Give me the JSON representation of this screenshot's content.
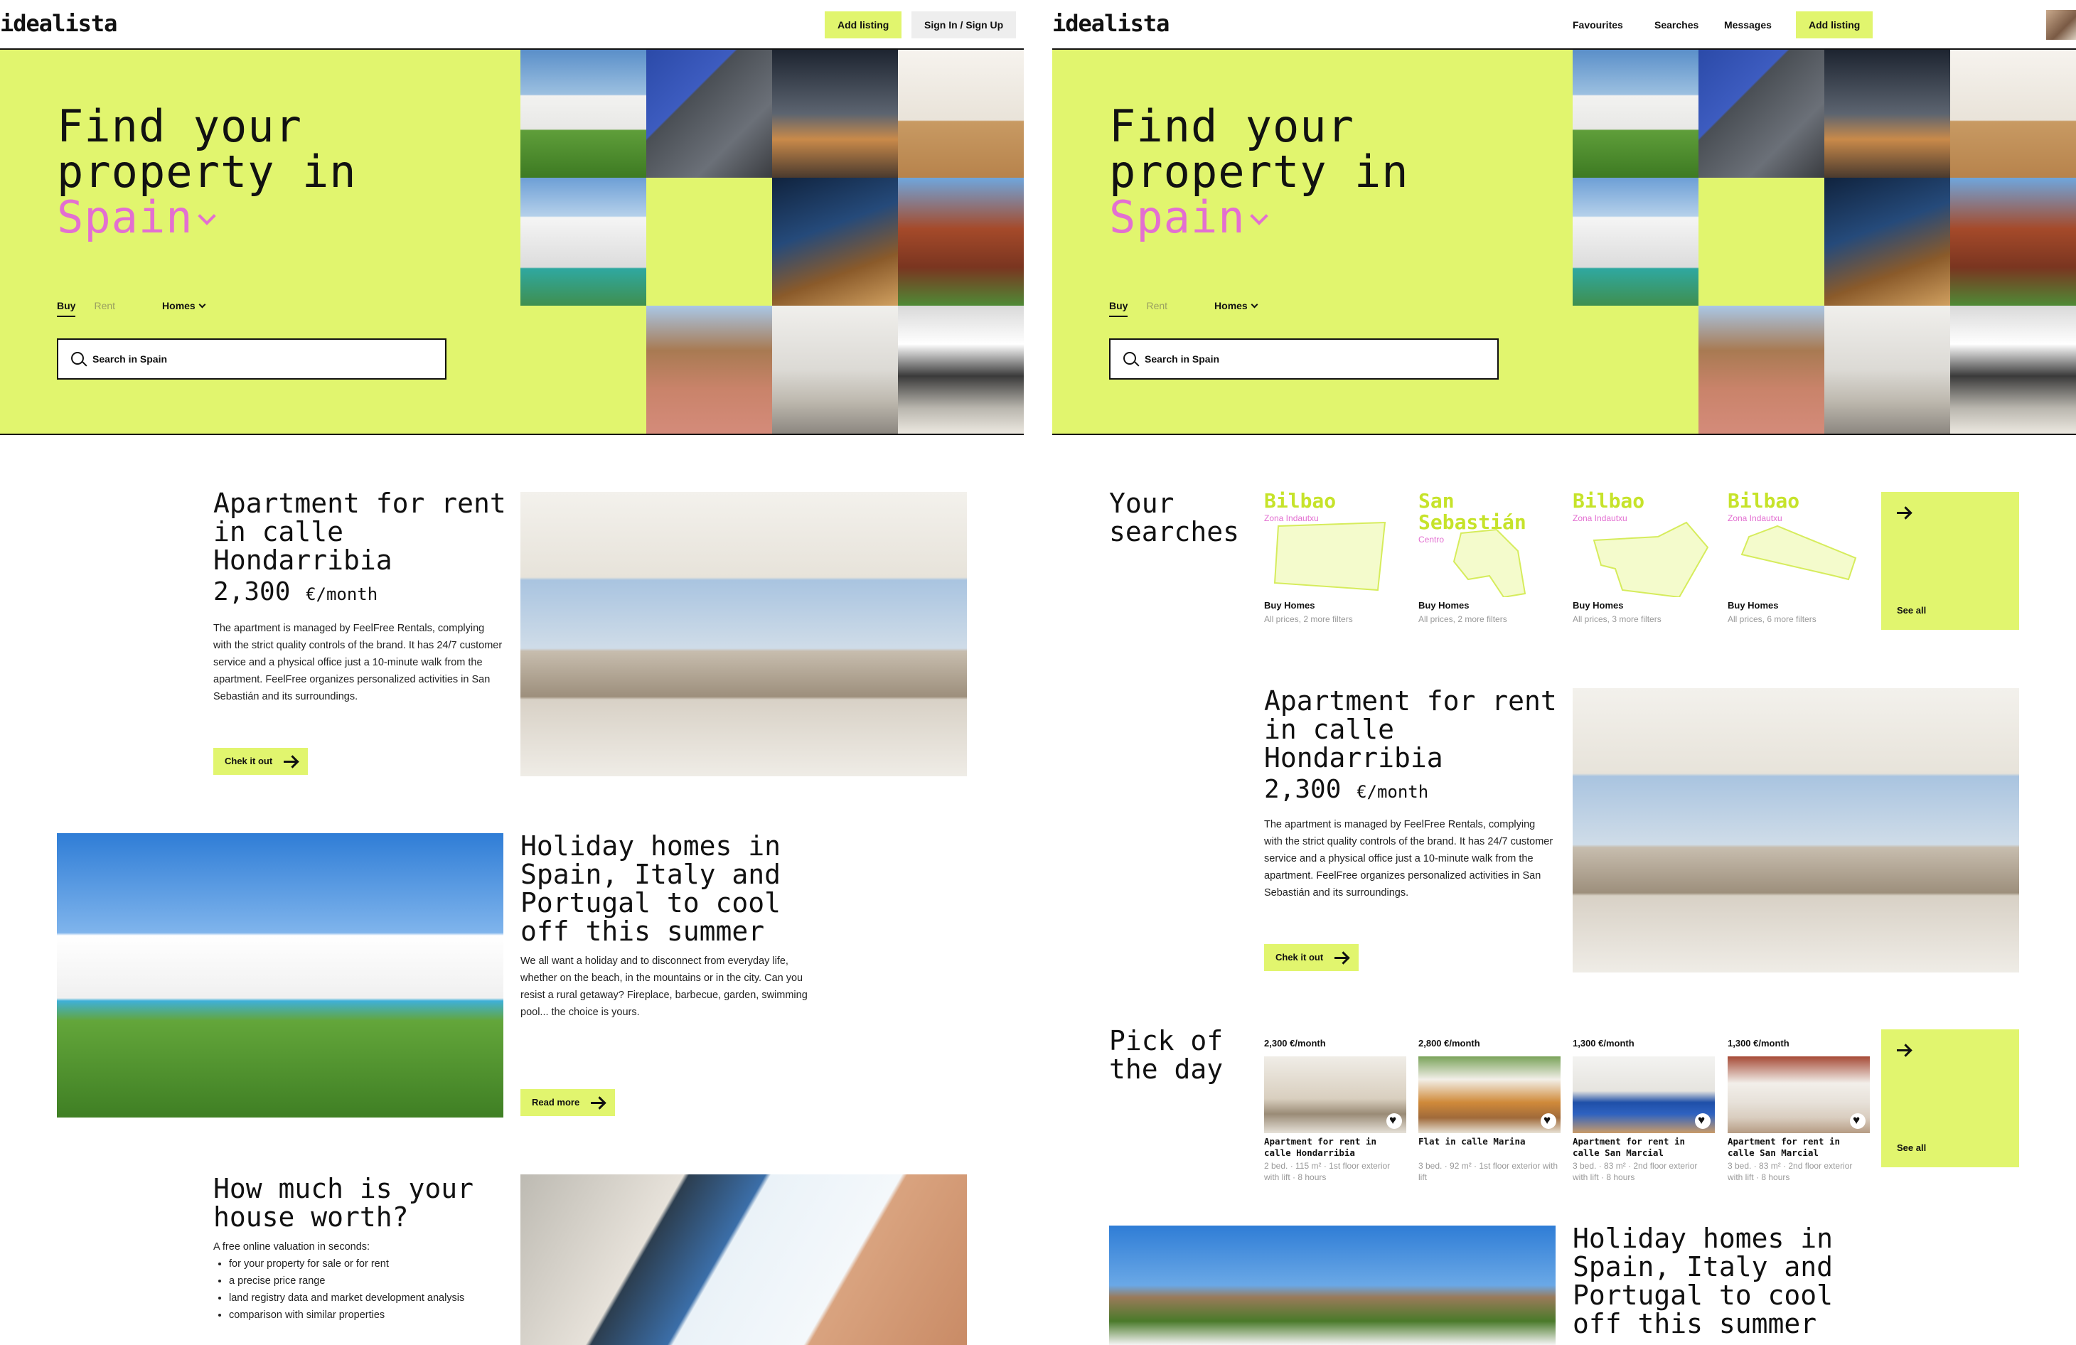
{
  "brand": "idealista",
  "left": {
    "nav": {
      "add_listing": "Add listing",
      "sign_in": "Sign In / Sign Up"
    },
    "hero": {
      "title_line1": "Find your",
      "title_line2": "property in",
      "location": "Spain",
      "tab_buy": "Buy",
      "tab_rent": "Rent",
      "type": "Homes",
      "search_placeholder": "Search in Spain"
    },
    "feature1": {
      "title": "Apartment for rent in calle Hondarribia",
      "price": "2,300",
      "unit": "€/month",
      "description": "The apartment is managed by FeelFree Rentals, complying with the strict quality controls of the brand. It has 24/7 customer service and a physical office just a 10-minute walk from the apartment. FeelFree organizes personalized activities in San Sebastián and its surroundings.",
      "cta": "Chek it out"
    },
    "feature2": {
      "title": "Holiday homes in Spain, Italy and Portugal to cool off this summer",
      "description": "We all want a holiday and to disconnect from everyday life, whether on the beach, in the mountains or in the city. Can you resist a rural getaway? Fireplace, barbecue, garden, swimming pool... the choice is yours.",
      "cta": "Read more"
    },
    "feature3": {
      "title": "How much is your house worth?",
      "intro": "A free online valuation in seconds:",
      "bullets": [
        "for your property for sale or for rent",
        "a precise price range",
        "land registry data and market development analysis",
        "comparison with similar properties"
      ]
    }
  },
  "right": {
    "nav": {
      "favourites": "Favourites",
      "searches": "Searches",
      "messages": "Messages",
      "add_listing": "Add listing"
    },
    "hero": {
      "title_line1": "Find your",
      "title_line2": "property in",
      "location": "Spain",
      "tab_buy": "Buy",
      "tab_rent": "Rent",
      "type": "Homes",
      "search_placeholder": "Search in Spain"
    },
    "searches": {
      "title": "Your searches",
      "see_all": "See all",
      "items": [
        {
          "city": "Bilbao",
          "zone": "Zona Indautxu",
          "type": "Buy Homes",
          "filters": "All prices, 2 more filters"
        },
        {
          "city": "San Sebastián",
          "zone": "Centro",
          "type": "Buy Homes",
          "filters": "All prices, 2 more filters"
        },
        {
          "city": "Bilbao",
          "zone": "Zona Indautxu",
          "type": "Buy Homes",
          "filters": "All prices, 3 more filters"
        },
        {
          "city": "Bilbao",
          "zone": "Zona Indautxu",
          "type": "Buy Homes",
          "filters": "All prices, 6 more filters"
        }
      ]
    },
    "feature1": {
      "title": "Apartment for rent in calle Hondarribia",
      "price": "2,300",
      "unit": "€/month",
      "description": "The apartment is managed by FeelFree Rentals, complying with the strict quality controls of the brand. It has 24/7 customer service and a physical office just a 10-minute walk from the apartment. FeelFree organizes personalized activities in San Sebastián and its surroundings.",
      "cta": "Chek it out"
    },
    "pick": {
      "title": "Pick of the day",
      "see_all": "See all",
      "items": [
        {
          "price": "2,300 €/month",
          "name": "Apartment for rent in calle Hondarribia",
          "meta": "2 bed. · 115 m² · 1st floor exterior with lift · 8 hours"
        },
        {
          "price": "2,800 €/month",
          "name": "Flat in calle Marina",
          "meta": "3 bed. · 92 m² · 1st floor exterior with lift"
        },
        {
          "price": "1,300 €/month",
          "name": "Apartment for rent in calle San Marcial",
          "meta": "3 bed. · 83 m² · 2nd floor exterior with lift · 8 hours"
        },
        {
          "price": "1,300 €/month",
          "name": "Apartment for rent in calle San Marcial",
          "meta": "3 bed. · 83 m² · 2nd floor exterior with lift · 8 hours"
        }
      ]
    },
    "feature2": {
      "title": "Holiday homes in Spain, Italy and Portugal to cool off this summer"
    }
  },
  "colors": {
    "accent": "#e1f56e",
    "pink": "#e36fd1",
    "ink": "#111111"
  },
  "icons": [
    "search-icon",
    "chevron-down-icon",
    "arrow-right-icon",
    "heart-icon",
    "avatar"
  ]
}
